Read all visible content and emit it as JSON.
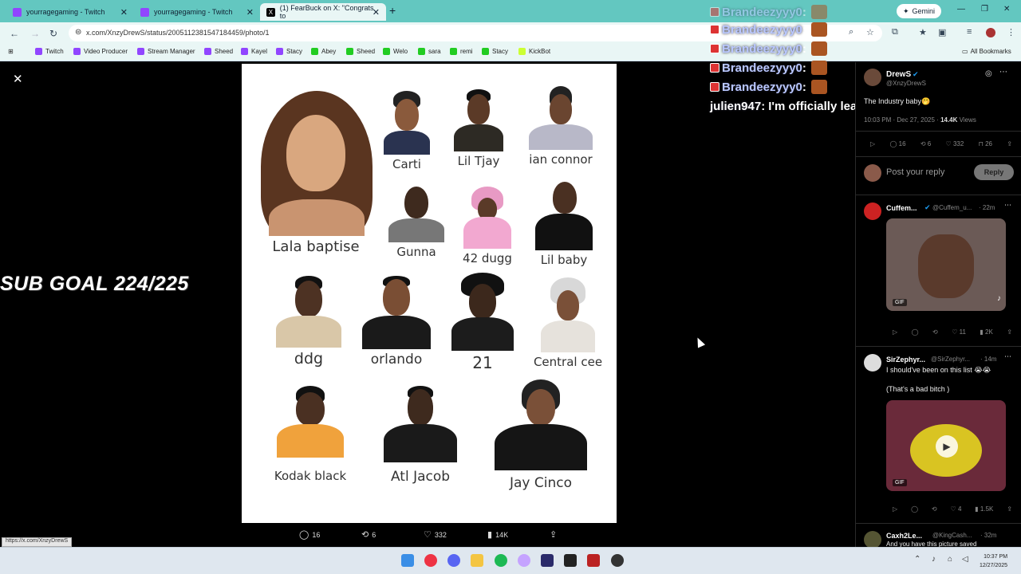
{
  "browser": {
    "tabs": [
      {
        "label": "yourragegaming - Twitch"
      },
      {
        "label": "yourragegaming - Twitch"
      },
      {
        "label": "(1) FearBuck on X: \"Congrats to"
      }
    ],
    "gemini_label": "Gemini",
    "url": "x.com/XnzyDrewS/status/2005112381547184459/photo/1",
    "bookmarks": [
      "Twitch",
      "Video Producer",
      "Stream Manager",
      "Sheed",
      "Kayel",
      "Stacy",
      "Abey",
      "Sheed",
      "Welo",
      "sara",
      "remi",
      "Stacy",
      "KickBot"
    ],
    "all_bookmarks": "All Bookmarks",
    "status_url": "https://x.com/XnzyDrewS"
  },
  "stream": {
    "sub_goal": "SUB GOAL 224/225",
    "chat": [
      {
        "user": "Brandeezyyy0",
        "msg": ""
      },
      {
        "user": "Brandeezyyy0",
        "msg": ""
      },
      {
        "user": "Brandeezyyy0",
        "msg": ""
      },
      {
        "user": "Brandeezyyy0",
        "msg": ""
      },
      {
        "user": "Brandeezyyy0",
        "msg": ""
      },
      {
        "user": "julien947",
        "msg": "I'm officially leaving Faze"
      }
    ]
  },
  "photo": {
    "people": [
      {
        "name": "Lala baptise"
      },
      {
        "name": "Carti"
      },
      {
        "name": "Lil Tjay"
      },
      {
        "name": "ian connor"
      },
      {
        "name": "Gunna"
      },
      {
        "name": "42 dugg"
      },
      {
        "name": "Lil baby"
      },
      {
        "name": "ddg"
      },
      {
        "name": "orlando"
      },
      {
        "name": "21"
      },
      {
        "name": "Central cee"
      },
      {
        "name": "Kodak black"
      },
      {
        "name": "Atl Jacob"
      },
      {
        "name": "Jay Cinco"
      }
    ],
    "actions": {
      "replies": "16",
      "reposts": "6",
      "likes": "332",
      "views": "14K"
    }
  },
  "post": {
    "author": "DrewS",
    "handle": "@XnzyDrewS",
    "text": "The Industry baby🤭",
    "time": "10:03 PM · Dec 27, 2025 ·",
    "views": "14.4K",
    "views_label": "Views",
    "stats": {
      "replies": "16",
      "reposts": "6",
      "likes": "332",
      "bookmarks": "26"
    },
    "reply_placeholder": "Post your reply",
    "reply_button": "Reply"
  },
  "replies": [
    {
      "name": "Cuffem...",
      "handle": "@Cuffem_u...",
      "time": "· 22m",
      "text": "",
      "media": "GIF",
      "stats": {
        "likes": "11",
        "views": "2K"
      }
    },
    {
      "name": "SirZephyr...",
      "handle": "@SirZephyr...",
      "time": "· 14m",
      "text": "I should've been on this list 😭😭",
      "text2": "(That's a bad bitch )",
      "media": "GIF",
      "stats": {
        "likes": "4",
        "views": "1.5K"
      }
    },
    {
      "name": "Caxh2Le...",
      "handle": "@KingCash...",
      "time": "· 32m",
      "text": "And you have this picture saved"
    }
  ],
  "taskbar": {
    "time": "10:37 PM",
    "date": "12/27/2025"
  },
  "colors": {
    "tabbar": "#63c7c0",
    "chrome": "#e9f6f5",
    "verified": "#1d9bf0"
  }
}
